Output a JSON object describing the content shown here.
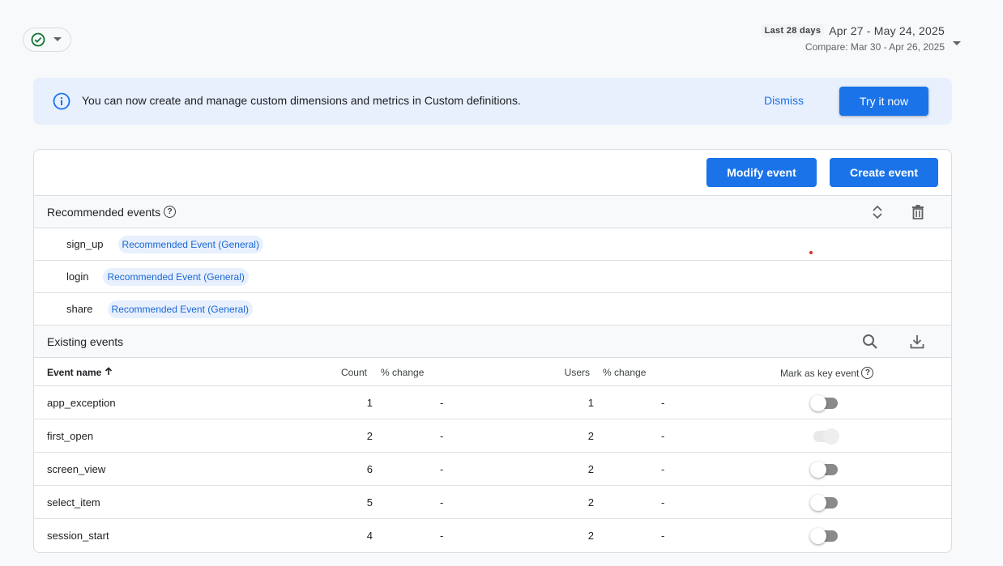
{
  "header": {
    "status_icon": "check-circle-icon",
    "date_range": {
      "badge": "Last 28 days",
      "range": "Apr 27 - May 24, 2025",
      "compare": "Compare: Mar 30 - Apr 26, 2025"
    }
  },
  "banner": {
    "text": "You can now create and manage custom dimensions and metrics in Custom definitions.",
    "dismiss_label": "Dismiss",
    "cta_label": "Try it now"
  },
  "toolbar": {
    "modify_label": "Modify event",
    "create_label": "Create event"
  },
  "recommended": {
    "title": "Recommended events",
    "help": "?",
    "items": [
      {
        "name": "sign_up",
        "chip": "Recommended Event (General)"
      },
      {
        "name": "login",
        "chip": "Recommended Event (General)"
      },
      {
        "name": "share",
        "chip": "Recommended Event (General)"
      }
    ]
  },
  "existing": {
    "title": "Existing events",
    "columns": {
      "name": "Event name",
      "count": "Count",
      "count_change": "% change",
      "users": "Users",
      "users_change": "% change",
      "key_event": "Mark as key event"
    },
    "rows": [
      {
        "name": "app_exception",
        "count": "1",
        "count_change": "-",
        "users": "1",
        "users_change": "-",
        "key_event": "off"
      },
      {
        "name": "first_open",
        "count": "2",
        "count_change": "-",
        "users": "2",
        "users_change": "-",
        "key_event": "disabled-on"
      },
      {
        "name": "screen_view",
        "count": "6",
        "count_change": "-",
        "users": "2",
        "users_change": "-",
        "key_event": "off"
      },
      {
        "name": "select_item",
        "count": "5",
        "count_change": "-",
        "users": "2",
        "users_change": "-",
        "key_event": "off"
      },
      {
        "name": "session_start",
        "count": "4",
        "count_change": "-",
        "users": "2",
        "users_change": "-",
        "key_event": "off"
      }
    ]
  },
  "colors": {
    "accent": "#1a73e8",
    "banner_bg": "#e8f0fe",
    "status_ok": "#137333"
  }
}
